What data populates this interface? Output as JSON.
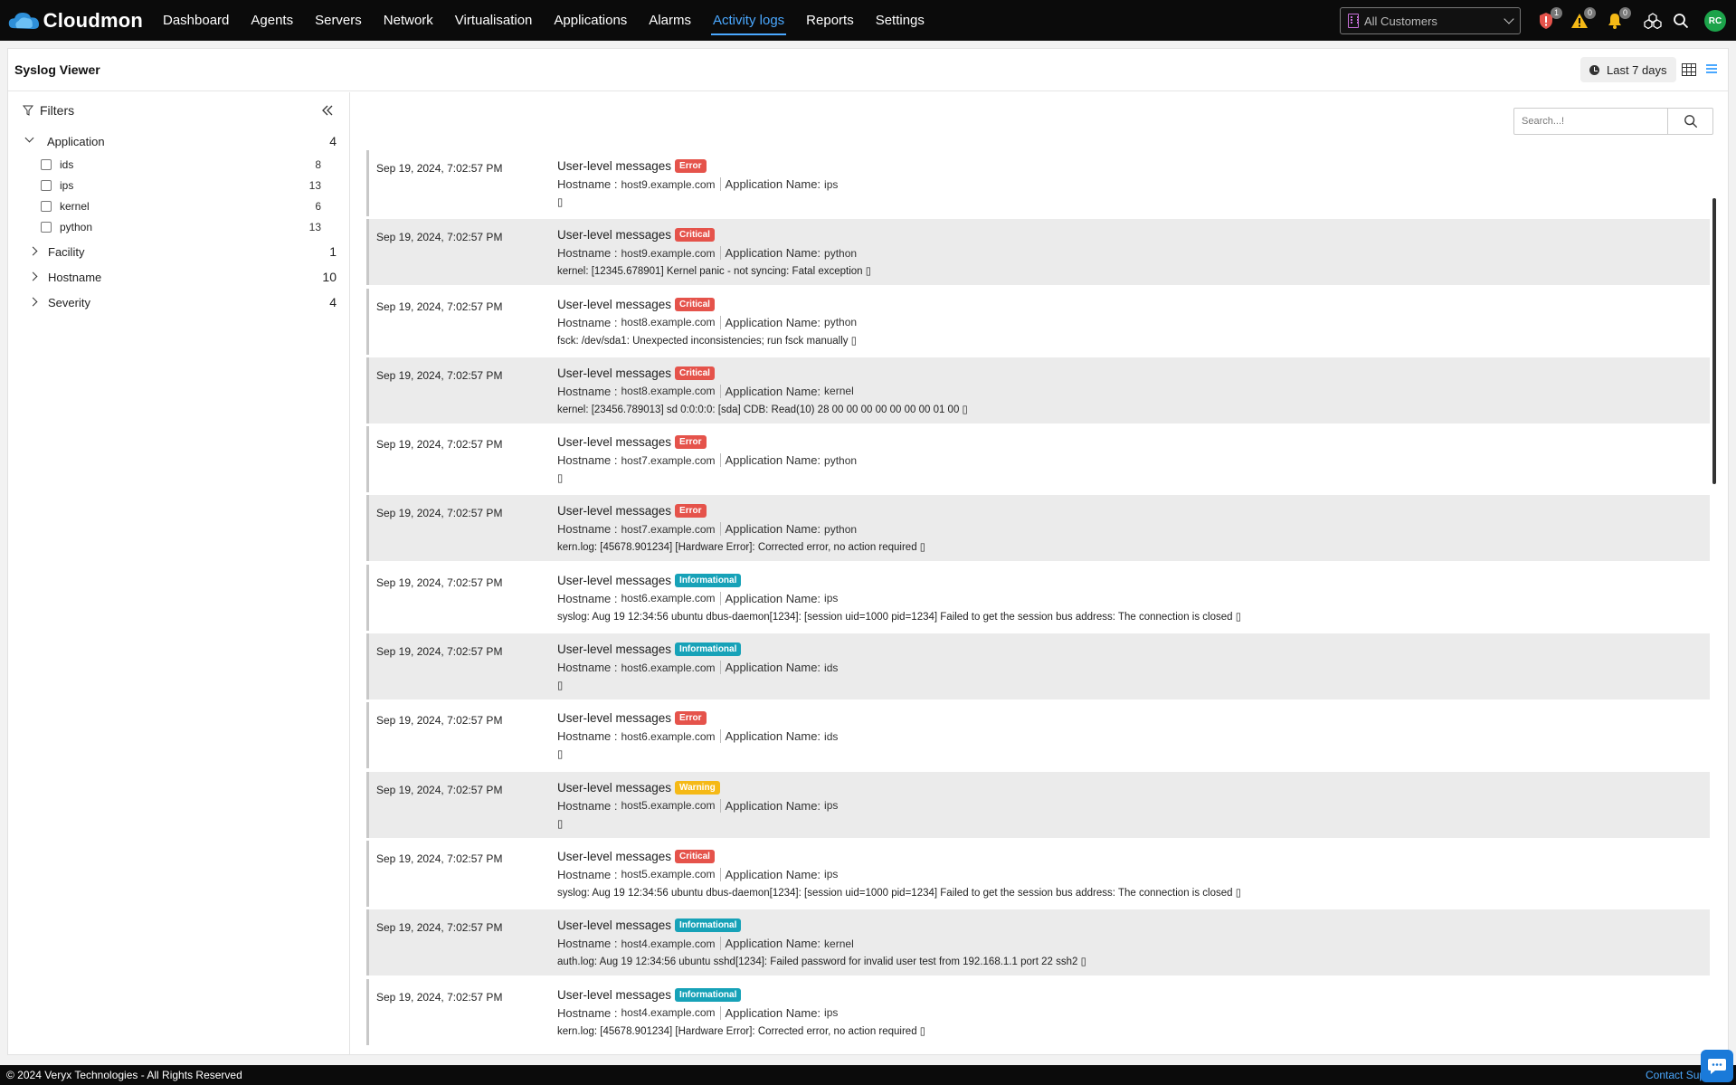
{
  "app": {
    "name": "Cloudmon"
  },
  "nav": [
    {
      "label": "Dashboard",
      "active": false
    },
    {
      "label": "Agents",
      "active": false
    },
    {
      "label": "Servers",
      "active": false
    },
    {
      "label": "Network",
      "active": false
    },
    {
      "label": "Virtualisation",
      "active": false
    },
    {
      "label": "Applications",
      "active": false
    },
    {
      "label": "Alarms",
      "active": false
    },
    {
      "label": "Activity logs",
      "active": true
    },
    {
      "label": "Reports",
      "active": false
    },
    {
      "label": "Settings",
      "active": false
    }
  ],
  "topbar": {
    "customer_select": "All Customers",
    "badges": {
      "security": "1",
      "warning": "0",
      "notifications": "0"
    },
    "avatar": "RC",
    "icons": [
      "shield-alert-icon",
      "warning-icon",
      "bell-icon",
      "apps-icon",
      "search-icon"
    ],
    "colors": {
      "accent": "#4aa8ff",
      "avatar": "#1ca34a"
    }
  },
  "page": {
    "title": "Syslog Viewer",
    "time_range": "Last 7 days",
    "search_placeholder": "Search...!"
  },
  "filters": {
    "title": "Filters",
    "groups": [
      {
        "label": "Application",
        "count": "4",
        "open": true,
        "options": [
          {
            "label": "ids",
            "count": "8"
          },
          {
            "label": "ips",
            "count": "13"
          },
          {
            "label": "kernel",
            "count": "6"
          },
          {
            "label": "python",
            "count": "13"
          }
        ]
      },
      {
        "label": "Facility",
        "count": "1",
        "open": false
      },
      {
        "label": "Hostname",
        "count": "10",
        "open": false
      },
      {
        "label": "Severity",
        "count": "4",
        "open": false
      }
    ]
  },
  "log_labels": {
    "hostname": "Hostname :",
    "appname": "Application Name:"
  },
  "logs": [
    {
      "time": "Sep 19, 2024, 7:02:57 PM",
      "title": "User-level messages",
      "severity": "Error",
      "sev_class": "error",
      "hostname": "host9.example.com",
      "app": "ips",
      "message": "▯"
    },
    {
      "time": "Sep 19, 2024, 7:02:57 PM",
      "title": "User-level messages",
      "severity": "Critical",
      "sev_class": "critical",
      "hostname": "host9.example.com",
      "app": "python",
      "message": "kernel: [12345.678901] Kernel panic - not syncing: Fatal exception ▯"
    },
    {
      "time": "Sep 19, 2024, 7:02:57 PM",
      "title": "User-level messages",
      "severity": "Critical",
      "sev_class": "critical",
      "hostname": "host8.example.com",
      "app": "python",
      "message": "fsck: /dev/sda1: Unexpected inconsistencies; run fsck manually ▯"
    },
    {
      "time": "Sep 19, 2024, 7:02:57 PM",
      "title": "User-level messages",
      "severity": "Critical",
      "sev_class": "critical",
      "hostname": "host8.example.com",
      "app": "kernel",
      "message": "kernel: [23456.789013] sd 0:0:0:0: [sda] CDB: Read(10) 28 00 00 00 00 00 00 00 01 00 ▯"
    },
    {
      "time": "Sep 19, 2024, 7:02:57 PM",
      "title": "User-level messages",
      "severity": "Error",
      "sev_class": "error",
      "hostname": "host7.example.com",
      "app": "python",
      "message": "▯"
    },
    {
      "time": "Sep 19, 2024, 7:02:57 PM",
      "title": "User-level messages",
      "severity": "Error",
      "sev_class": "error",
      "hostname": "host7.example.com",
      "app": "python",
      "message": "kern.log: [45678.901234] [Hardware Error]: Corrected error, no action required ▯"
    },
    {
      "time": "Sep 19, 2024, 7:02:57 PM",
      "title": "User-level messages",
      "severity": "Informational",
      "sev_class": "informational",
      "hostname": "host6.example.com",
      "app": "ips",
      "message": "syslog: Aug 19 12:34:56 ubuntu dbus-daemon[1234]: [session uid=1000 pid=1234] Failed to get the session bus address: The connection is closed ▯"
    },
    {
      "time": "Sep 19, 2024, 7:02:57 PM",
      "title": "User-level messages",
      "severity": "Informational",
      "sev_class": "informational",
      "hostname": "host6.example.com",
      "app": "ids",
      "message": "▯"
    },
    {
      "time": "Sep 19, 2024, 7:02:57 PM",
      "title": "User-level messages",
      "severity": "Error",
      "sev_class": "error",
      "hostname": "host6.example.com",
      "app": "ids",
      "message": "▯"
    },
    {
      "time": "Sep 19, 2024, 7:02:57 PM",
      "title": "User-level messages",
      "severity": "Warning",
      "sev_class": "warning",
      "hostname": "host5.example.com",
      "app": "ips",
      "message": "▯"
    },
    {
      "time": "Sep 19, 2024, 7:02:57 PM",
      "title": "User-level messages",
      "severity": "Critical",
      "sev_class": "critical",
      "hostname": "host5.example.com",
      "app": "ips",
      "message": "syslog: Aug 19 12:34:56 ubuntu dbus-daemon[1234]: [session uid=1000 pid=1234] Failed to get the session bus address: The connection is closed ▯"
    },
    {
      "time": "Sep 19, 2024, 7:02:57 PM",
      "title": "User-level messages",
      "severity": "Informational",
      "sev_class": "informational",
      "hostname": "host4.example.com",
      "app": "kernel",
      "message": "auth.log: Aug 19 12:34:56 ubuntu sshd[1234]: Failed password for invalid user test from 192.168.1.1 port 22 ssh2 ▯"
    },
    {
      "time": "Sep 19, 2024, 7:02:57 PM",
      "title": "User-level messages",
      "severity": "Informational",
      "sev_class": "informational",
      "hostname": "host4.example.com",
      "app": "ips",
      "message": "kern.log: [45678.901234] [Hardware Error]: Corrected error, no action required ▯"
    }
  ],
  "footer": {
    "copyright": "© 2024 Veryx Technologies - All Rights Reserved",
    "contact": "Contact Sup"
  }
}
